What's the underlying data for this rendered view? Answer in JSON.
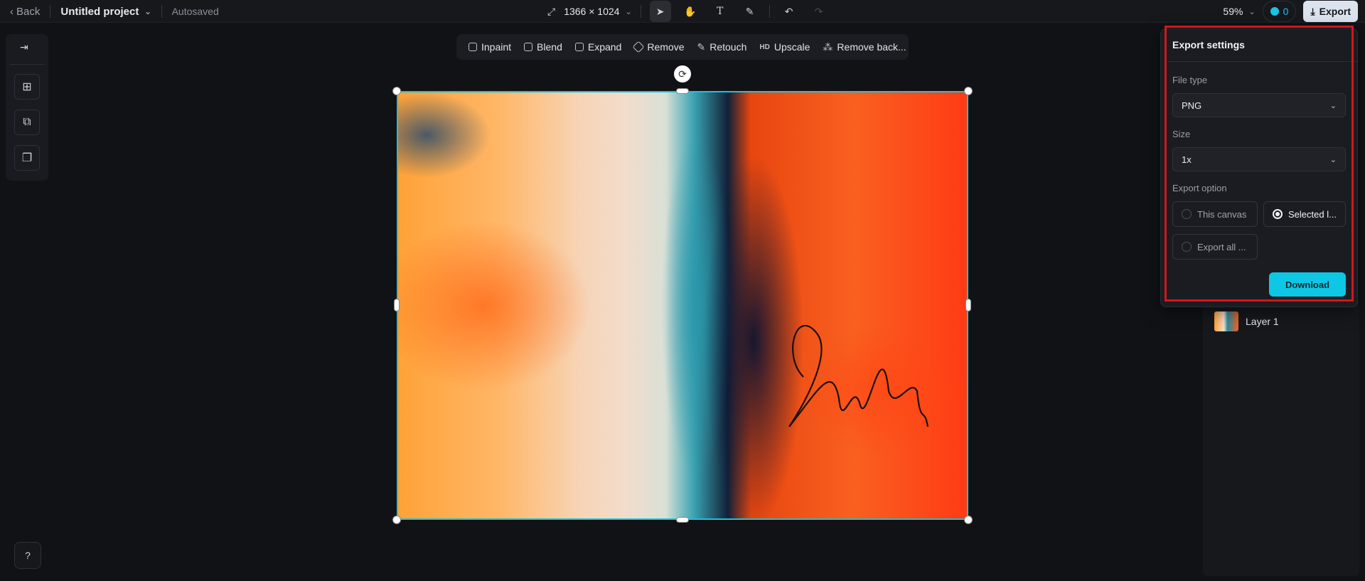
{
  "topbar": {
    "back_label": "Back",
    "project_name": "Untitled project",
    "autosave_status": "Autosaved",
    "canvas_size": "1366 × 1024",
    "zoom": "59%",
    "credits": "0",
    "export_label": "Export"
  },
  "ai_tools": [
    {
      "label": "Inpaint",
      "icon": "inpaint-icon"
    },
    {
      "label": "Blend",
      "icon": "blend-icon"
    },
    {
      "label": "Expand",
      "icon": "expand-icon"
    },
    {
      "label": "Remove",
      "icon": "eraser-icon"
    },
    {
      "label": "Retouch",
      "icon": "retouch-icon"
    },
    {
      "label": "Upscale",
      "icon": "hd-icon",
      "prefix": "HD"
    },
    {
      "label": "Remove back...",
      "icon": "remove-background-icon"
    }
  ],
  "layers": [
    {
      "name": "Layer 1"
    }
  ],
  "export_panel": {
    "title": "Export settings",
    "file_type_label": "File type",
    "file_type_value": "PNG",
    "size_label": "Size",
    "size_value": "1x",
    "export_option_label": "Export option",
    "options": [
      {
        "label": "This canvas",
        "selected": false
      },
      {
        "label": "Selected l...",
        "selected": true
      },
      {
        "label": "Export all ...",
        "selected": false
      }
    ],
    "download_label": "Download"
  },
  "colors": {
    "accent": "#0ec7e4",
    "highlight": "#d0171d",
    "selection": "#1bc4d8"
  }
}
